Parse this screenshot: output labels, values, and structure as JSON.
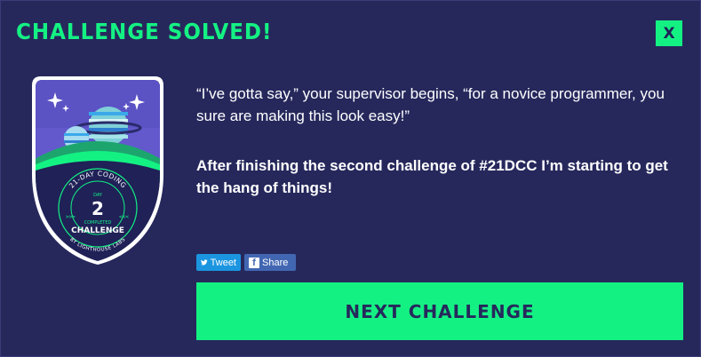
{
  "modal": {
    "title": "CHALLENGE SOLVED!",
    "close_label": "X",
    "quote": "“I’ve gotta say,” your supervisor begins, “for a novice programmer, you sure are making this look easy!”",
    "tagline": "After finishing the second challenge of #21DCC I’m starting to get the hang of things!",
    "next_label": "NEXT CHALLENGE"
  },
  "social": {
    "tweet_label": "Tweet",
    "share_label": "Share"
  },
  "badge": {
    "top_arc": "21-DAY CODING",
    "day_label": "DAY",
    "day_number": "2",
    "completed": "COMPLETED",
    "challenge": "CHALLENGE",
    "bottom_arc": "BY LIGHTHOUSE LABS"
  },
  "colors": {
    "background": "#26285c",
    "accent": "#14f183",
    "badge_sky": "#5b52c4",
    "badge_inner": "#1f2157"
  }
}
